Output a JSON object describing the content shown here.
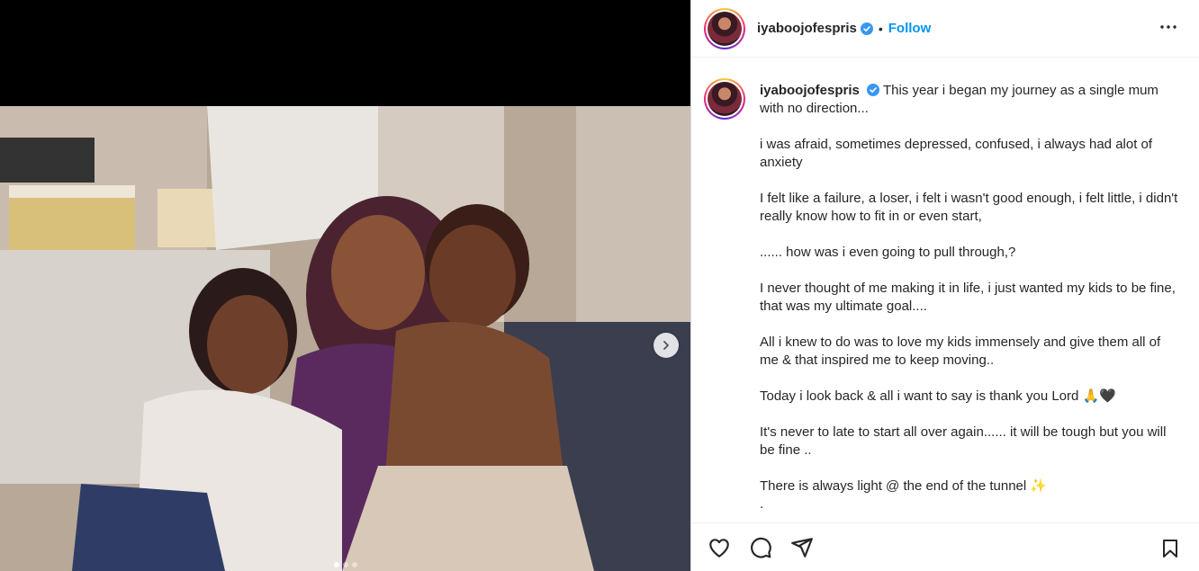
{
  "post": {
    "username": "iyaboojofespris",
    "separator": "•",
    "follow_label": "Follow",
    "caption_first": "This year i began my journey as a single mum with no direction...",
    "paragraphs": [
      "i was afraid, sometimes depressed, confused, i always had alot of anxiety",
      "I felt like a failure, a loser, i felt i wasn't good enough, i felt little, i didn't really know how to fit in or even start,",
      "...... how was i even going to pull through,?",
      "I never thought of me making it in life, i just wanted my kids to be fine, that was my ultimate goal....",
      "All i knew to do was to love my kids immensely and give them all of me & that inspired me to keep moving..",
      "Today i look back & all i want to say is thank you Lord 🙏🖤",
      "It's never to late to start all over again...... it will be tough but you will be fine ..",
      "There is always light @ the end of the tunnel ✨",
      "."
    ]
  },
  "carousel": {
    "current": 1,
    "total": 3
  },
  "icons": {
    "verified": "verified-badge-icon",
    "more": "more-options-icon",
    "like": "heart-icon",
    "comment": "comment-icon",
    "share": "share-icon",
    "save": "bookmark-icon",
    "next": "chevron-right-icon"
  },
  "colors": {
    "accent": "#0095f6",
    "text": "#262626",
    "verified": "#3897f0"
  }
}
